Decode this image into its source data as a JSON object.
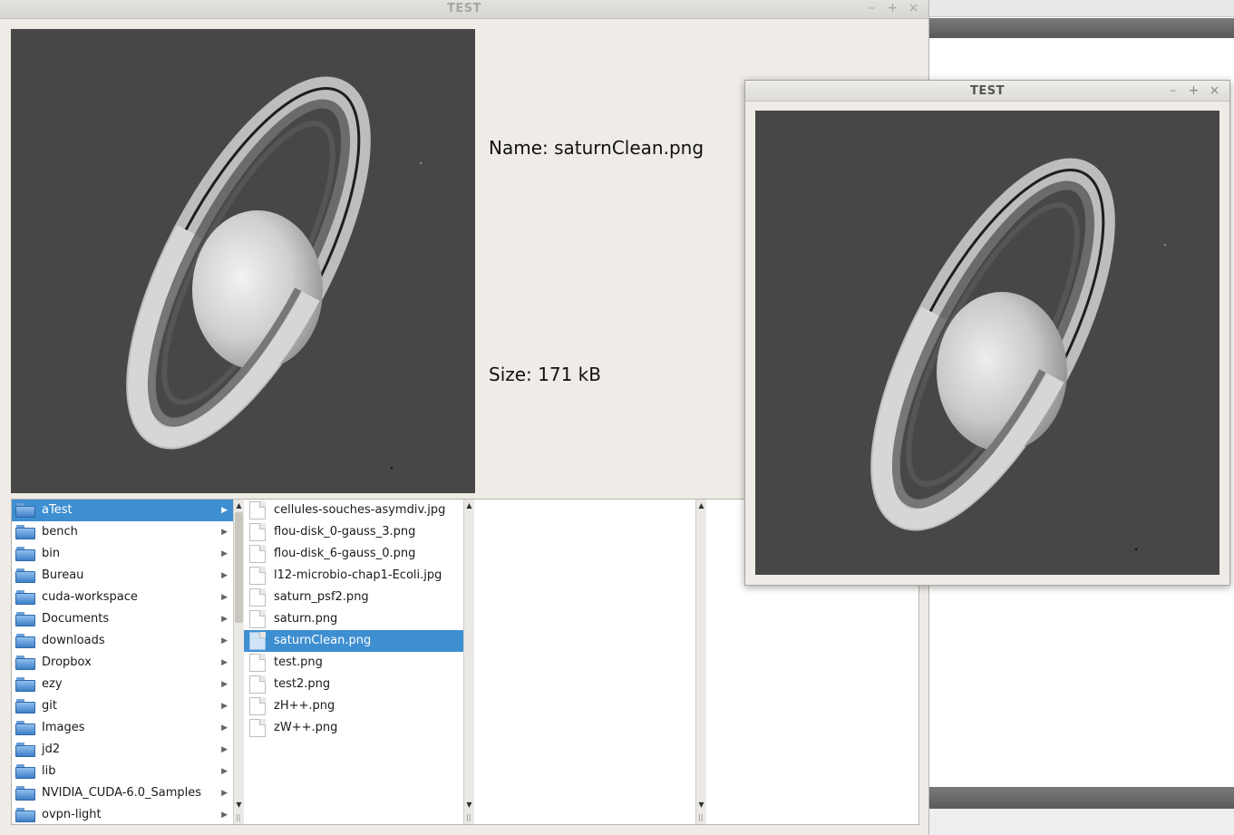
{
  "main_window": {
    "title": "TEST",
    "controls": {
      "minimize": "–",
      "maximize": "+",
      "close": "×"
    },
    "info": {
      "name_text": "Name: saturnClean.png",
      "size_text": "Size: 171 kB"
    },
    "image_icon": "saturn-image"
  },
  "browser": {
    "folders": [
      {
        "label": "aTest",
        "selected": true
      },
      {
        "label": "bench"
      },
      {
        "label": "bin"
      },
      {
        "label": "Bureau"
      },
      {
        "label": "cuda-workspace"
      },
      {
        "label": "Documents"
      },
      {
        "label": "downloads"
      },
      {
        "label": "Dropbox"
      },
      {
        "label": "ezy"
      },
      {
        "label": "git"
      },
      {
        "label": "Images"
      },
      {
        "label": "jd2"
      },
      {
        "label": "lib"
      },
      {
        "label": "NVIDIA_CUDA-6.0_Samples"
      },
      {
        "label": "ovpn-light"
      }
    ],
    "files": [
      {
        "label": "cellules-souches-asymdiv.jpg"
      },
      {
        "label": "flou-disk_0-gauss_3.png"
      },
      {
        "label": "flou-disk_6-gauss_0.png"
      },
      {
        "label": "l12-microbio-chap1-Ecoli.jpg"
      },
      {
        "label": "saturn_psf2.png"
      },
      {
        "label": "saturn.png"
      },
      {
        "label": "saturnClean.png",
        "selected": true
      },
      {
        "label": "test.png"
      },
      {
        "label": "test2.png"
      },
      {
        "label": "zH++.png"
      },
      {
        "label": "zW++.png"
      }
    ],
    "scroll": {
      "up": "▲",
      "down": "▼",
      "grip": "||"
    },
    "arrow": "▶"
  },
  "second_window": {
    "title": "TEST",
    "controls": {
      "minimize": "–",
      "maximize": "+",
      "close": "×"
    }
  },
  "colors": {
    "selection": "#3e8fd2",
    "image_background": "#474747",
    "window_background": "#efece7"
  }
}
